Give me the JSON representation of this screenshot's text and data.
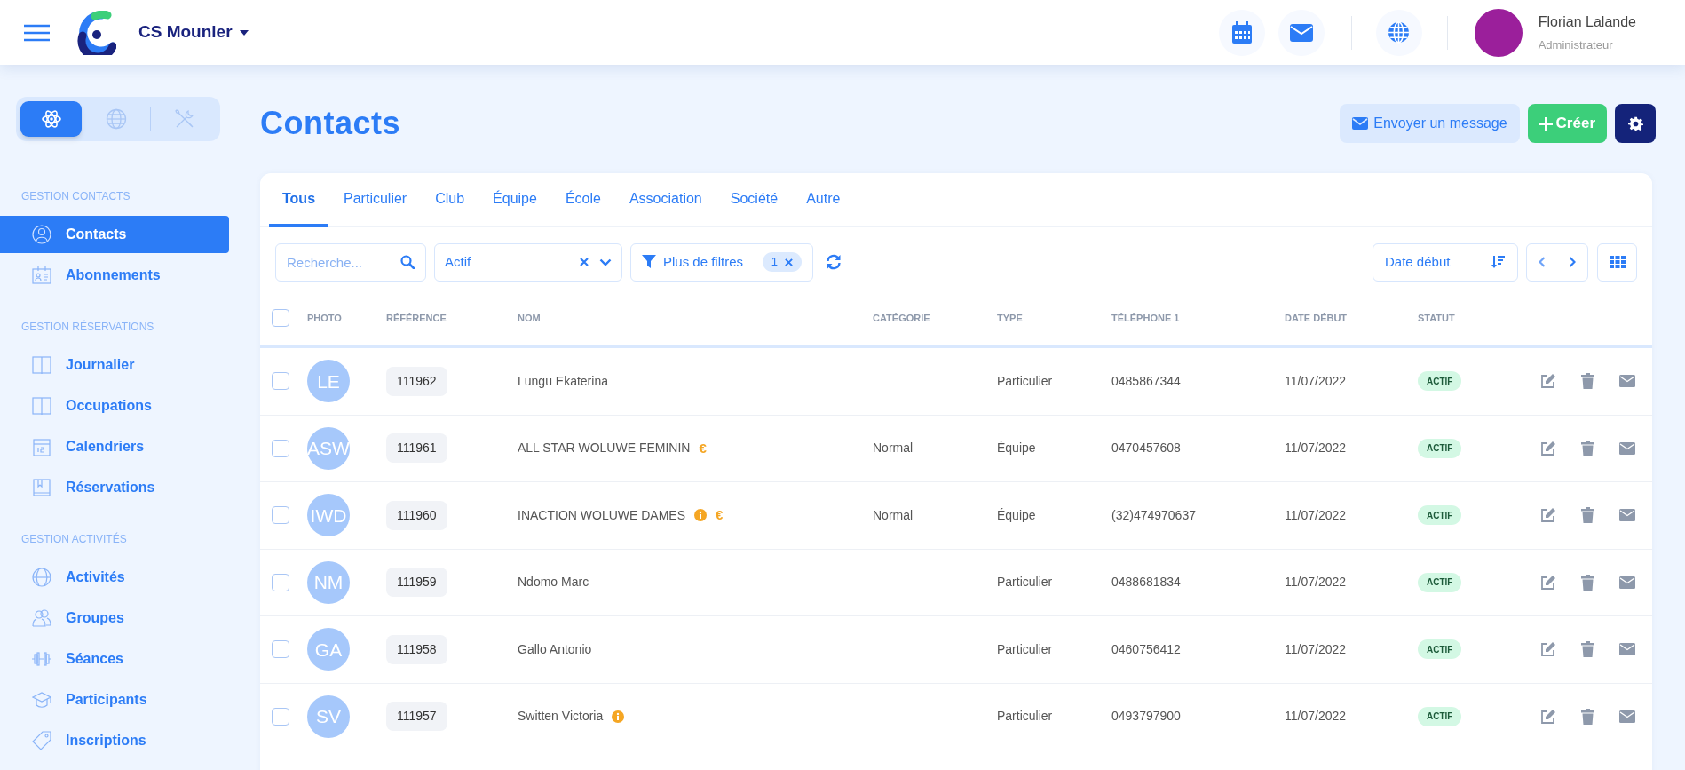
{
  "header": {
    "organization": "CS Mounier",
    "user": {
      "name": "Florian Lalande",
      "role": "Administrateur"
    }
  },
  "sidebar": {
    "modes": [
      {
        "kind": "atom",
        "selected": true
      },
      {
        "kind": "globe",
        "selected": false
      },
      {
        "kind": "tools",
        "selected": false
      }
    ],
    "sections": [
      {
        "title": "GESTION CONTACTS",
        "items": [
          {
            "label": "Contacts",
            "kind": "user",
            "selected": true
          },
          {
            "label": "Abonnements",
            "kind": "card",
            "selected": false
          }
        ]
      },
      {
        "title": "GESTION RÉSERVATIONS",
        "items": [
          {
            "label": "Journalier",
            "kind": "book",
            "selected": false
          },
          {
            "label": "Occupations",
            "kind": "book",
            "selected": false
          },
          {
            "label": "Calendriers",
            "kind": "calendar",
            "selected": false
          },
          {
            "label": "Réservations",
            "kind": "bookmark",
            "selected": false
          }
        ]
      },
      {
        "title": "GESTION ACTIVITÉS",
        "items": [
          {
            "label": "Activités",
            "kind": "ball",
            "selected": false
          },
          {
            "label": "Groupes",
            "kind": "users",
            "selected": false
          },
          {
            "label": "Séances",
            "kind": "dumbbell",
            "selected": false
          },
          {
            "label": "Participants",
            "kind": "cap",
            "selected": false
          },
          {
            "label": "Inscriptions",
            "kind": "tag",
            "selected": false
          }
        ]
      }
    ]
  },
  "page_title": "Contacts",
  "actions": [
    {
      "kind": "message",
      "label": "Envoyer un message"
    },
    {
      "kind": "create",
      "label": "Créer"
    },
    {
      "kind": "settings"
    }
  ],
  "tabs": [
    {
      "label": "Tous",
      "selected": true
    },
    {
      "label": "Particulier",
      "selected": false
    },
    {
      "label": "Club",
      "selected": false
    },
    {
      "label": "Équipe",
      "selected": false
    },
    {
      "label": "École",
      "selected": false
    },
    {
      "label": "Association",
      "selected": false
    },
    {
      "label": "Société",
      "selected": false
    },
    {
      "label": "Autre",
      "selected": false
    }
  ],
  "filters": {
    "search": {
      "placeholder": "Recherche..."
    },
    "status": {
      "value": "Actif"
    },
    "more_filters": {
      "label": "Plus de filtres",
      "count": "1"
    },
    "sort": {
      "label": "Date début"
    }
  },
  "table": {
    "all_checked": false,
    "columns": [
      "PHOTO",
      "RÉFÉRENCE",
      "NOM",
      "CATÉGORIE",
      "TYPE",
      "TÉLÉPHONE 1",
      "DATE DÉBUT",
      "STATUT"
    ],
    "rows": [
      {
        "checked": false,
        "initials": "LE",
        "reference": "111962",
        "name": "Lungu Ekaterina",
        "markers": [],
        "category": "",
        "type": "Particulier",
        "phone": "0485867344",
        "date": "11/07/2022",
        "status": "ACTIF"
      },
      {
        "checked": false,
        "initials": "ASW",
        "reference": "111961",
        "name": "ALL STAR WOLUWE FEMININ",
        "markers": [
          {
            "kind": "euro",
            "symbol": "€"
          }
        ],
        "category": "Normal",
        "type": "Équipe",
        "phone": "0470457608",
        "date": "11/07/2022",
        "status": "ACTIF"
      },
      {
        "checked": false,
        "initials": "IWD",
        "reference": "111960",
        "name": "INACTION WOLUWE DAMES",
        "markers": [
          {
            "kind": "info"
          },
          {
            "kind": "euro",
            "symbol": "€"
          }
        ],
        "category": "Normal",
        "type": "Équipe",
        "phone": "(32)474970637",
        "date": "11/07/2022",
        "status": "ACTIF"
      },
      {
        "checked": false,
        "initials": "NM",
        "reference": "111959",
        "name": "Ndomo Marc",
        "markers": [],
        "category": "",
        "type": "Particulier",
        "phone": "0488681834",
        "date": "11/07/2022",
        "status": "ACTIF"
      },
      {
        "checked": false,
        "initials": "GA",
        "reference": "111958",
        "name": "Gallo Antonio",
        "markers": [],
        "category": "",
        "type": "Particulier",
        "phone": "0460756412",
        "date": "11/07/2022",
        "status": "ACTIF"
      },
      {
        "checked": false,
        "initials": "SV",
        "reference": "111957",
        "name": "Switten Victoria",
        "markers": [
          {
            "kind": "info"
          }
        ],
        "category": "",
        "type": "Particulier",
        "phone": "0493797900",
        "date": "11/07/2022",
        "status": "ACTIF"
      }
    ]
  }
}
